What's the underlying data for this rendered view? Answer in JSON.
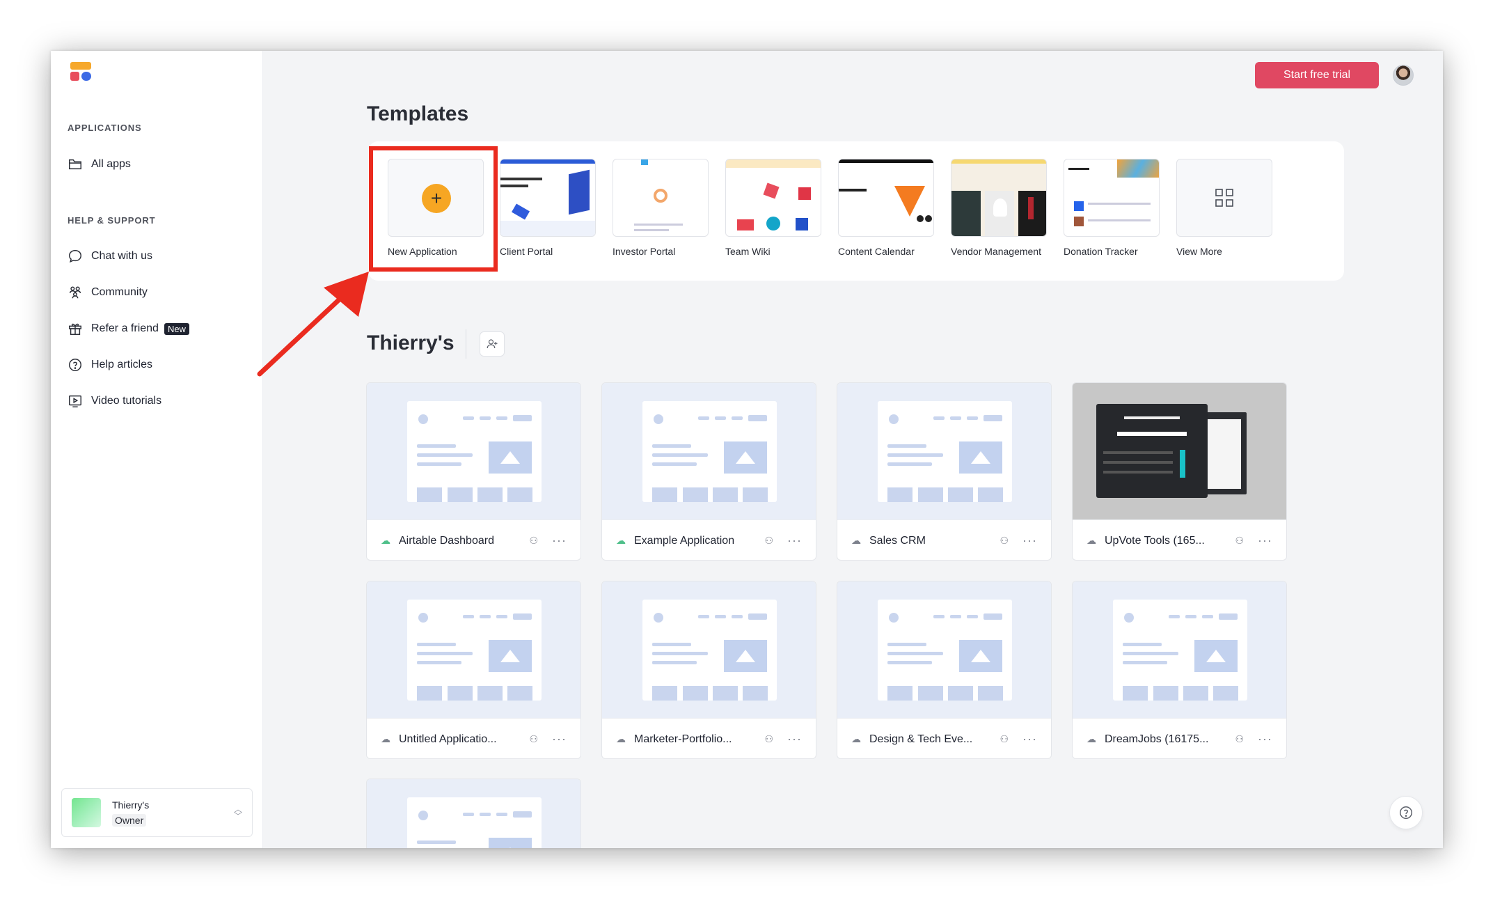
{
  "sidebar": {
    "applications_label": "APPLICATIONS",
    "all_apps": "All apps",
    "help_label": "HELP & SUPPORT",
    "items": [
      {
        "label": "Chat with us",
        "icon": "chat-bubble-icon"
      },
      {
        "label": "Community",
        "icon": "community-icon"
      },
      {
        "label": "Refer a friend",
        "icon": "gift-icon",
        "badge": "New"
      },
      {
        "label": "Help articles",
        "icon": "question-circle-icon"
      },
      {
        "label": "Video tutorials",
        "icon": "video-icon"
      }
    ],
    "workspace": {
      "name": "Thierry's",
      "role": "Owner"
    }
  },
  "header": {
    "trial_button": "Start free trial"
  },
  "templates": {
    "title": "Templates",
    "items": [
      {
        "label": "New Application"
      },
      {
        "label": "Client Portal"
      },
      {
        "label": "Investor Portal"
      },
      {
        "label": "Team Wiki"
      },
      {
        "label": "Content Calendar"
      },
      {
        "label": "Vendor Management"
      },
      {
        "label": "Donation Tracker"
      },
      {
        "label": "View More"
      }
    ]
  },
  "workspace_section": {
    "title": "Thierry's",
    "apps": [
      {
        "name": "Airtable Dashboard",
        "status": "synced"
      },
      {
        "name": "Example Application",
        "status": "synced"
      },
      {
        "name": "Sales CRM",
        "status": "offline"
      },
      {
        "name": "UpVote Tools (165...",
        "status": "offline"
      },
      {
        "name": "Untitled Applicatio...",
        "status": "offline"
      },
      {
        "name": "Marketer-Portfolio...",
        "status": "offline"
      },
      {
        "name": "Design & Tech Eve...",
        "status": "offline"
      },
      {
        "name": "DreamJobs (16175...",
        "status": "offline"
      }
    ]
  },
  "colors": {
    "brand_accent": "#e04862",
    "highlight": "#ea2b1f",
    "plus_button": "#f6a623"
  }
}
